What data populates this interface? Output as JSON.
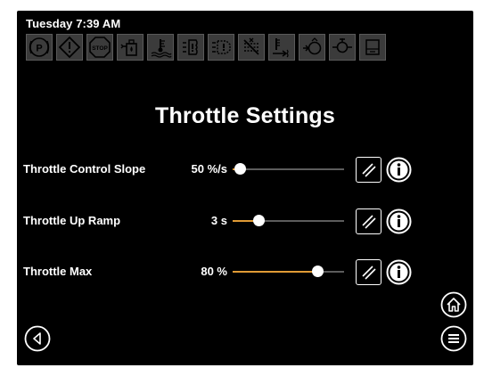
{
  "status": {
    "datetime": "Tuesday 7:39 AM"
  },
  "telltales": [
    {
      "icon": "parking-brake-icon"
    },
    {
      "icon": "warning-icon"
    },
    {
      "icon": "stop-icon",
      "label": "STOP"
    },
    {
      "icon": "fuel-water-icon"
    },
    {
      "icon": "coolant-temp-icon"
    },
    {
      "icon": "filter-restriction-icon"
    },
    {
      "icon": "transmission-icon"
    },
    {
      "icon": "regen-icon"
    },
    {
      "icon": "exhaust-temp-icon"
    },
    {
      "icon": "preheat-icon"
    },
    {
      "icon": "dpf-icon"
    },
    {
      "icon": "lamp-icon"
    }
  ],
  "page": {
    "title": "Throttle Settings"
  },
  "settings": [
    {
      "label": "Throttle Control Slope",
      "value": "50 %/s",
      "fraction": 0.07
    },
    {
      "label": "Throttle Up Ramp",
      "value": "3 s",
      "fraction": 0.24
    },
    {
      "label": "Throttle Max",
      "value": "80 %",
      "fraction": 0.77
    }
  ],
  "colors": {
    "accent": "#e09a35",
    "background": "#000000",
    "telltale_off": "#3b3b3b"
  },
  "nav": {
    "back": "back-icon",
    "home": "home-icon",
    "menu": "menu-icon"
  }
}
